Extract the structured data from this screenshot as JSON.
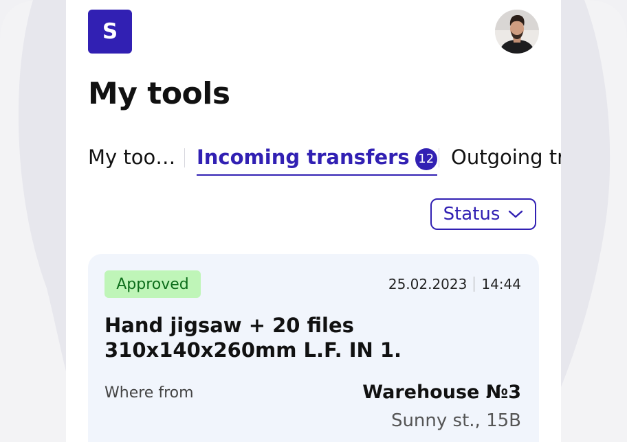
{
  "app": {
    "logo_letter": "S",
    "user_avatar": "user-avatar-photo"
  },
  "page": {
    "title": "My tools"
  },
  "tabs": {
    "items": [
      {
        "label": "My too…",
        "active": false
      },
      {
        "label": "Incoming transfers",
        "active": true,
        "count": "12"
      },
      {
        "label": "Outgoing tr",
        "active": false
      }
    ]
  },
  "filter": {
    "status_label": "Status",
    "icon": "chevron-down-icon"
  },
  "transfer": {
    "status": "Approved",
    "date": "25.02.2023",
    "time": "14:44",
    "title": "Hand jigsaw + 20 files 310x140x260mm L.F. IN 1.",
    "from_label": "Where from",
    "warehouse": "Warehouse №3",
    "address": "Sunny st., 15B"
  },
  "colors": {
    "accent": "#3120b3",
    "approved_bg": "#bff5b8",
    "approved_text": "#0d6e1b",
    "card_bg": "#f1f5fc",
    "background": "#f1f1f4"
  }
}
